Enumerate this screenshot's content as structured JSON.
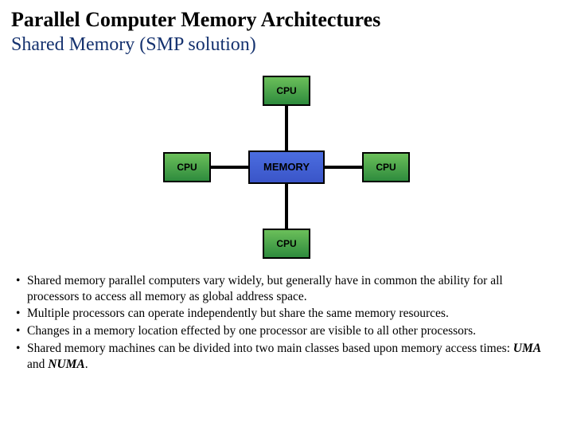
{
  "title": "Parallel Computer Memory Architectures",
  "subtitle": "Shared Memory (SMP solution)",
  "diagram": {
    "cpu_label": "CPU",
    "memory_label": "MEMORY",
    "layout": "UMA-star",
    "nodes": {
      "top": {
        "type": "cpu"
      },
      "bottom": {
        "type": "cpu"
      },
      "left": {
        "type": "cpu"
      },
      "right": {
        "type": "cpu"
      },
      "center": {
        "type": "memory"
      }
    },
    "edges": [
      [
        "top",
        "center"
      ],
      [
        "bottom",
        "center"
      ],
      [
        "left",
        "center"
      ],
      [
        "right",
        "center"
      ]
    ],
    "colors": {
      "cpu": "#3e9c49",
      "memory": "#4159cf",
      "line": "#000000"
    }
  },
  "bullets": [
    {
      "pre": "Shared memory parallel computers vary widely, but generally have in common the ability for all processors to access all memory as global address space."
    },
    {
      "pre": "Multiple processors can operate independently but share the same memory resources."
    },
    {
      "pre": "Changes in a memory location effected by one processor are visible to all other processors."
    },
    {
      "pre": "Shared memory machines can be divided into two main classes based upon memory access times: ",
      "em1": "UMA",
      "mid": " and ",
      "em2": "NUMA",
      "post": "."
    }
  ],
  "bullet_char": "•"
}
